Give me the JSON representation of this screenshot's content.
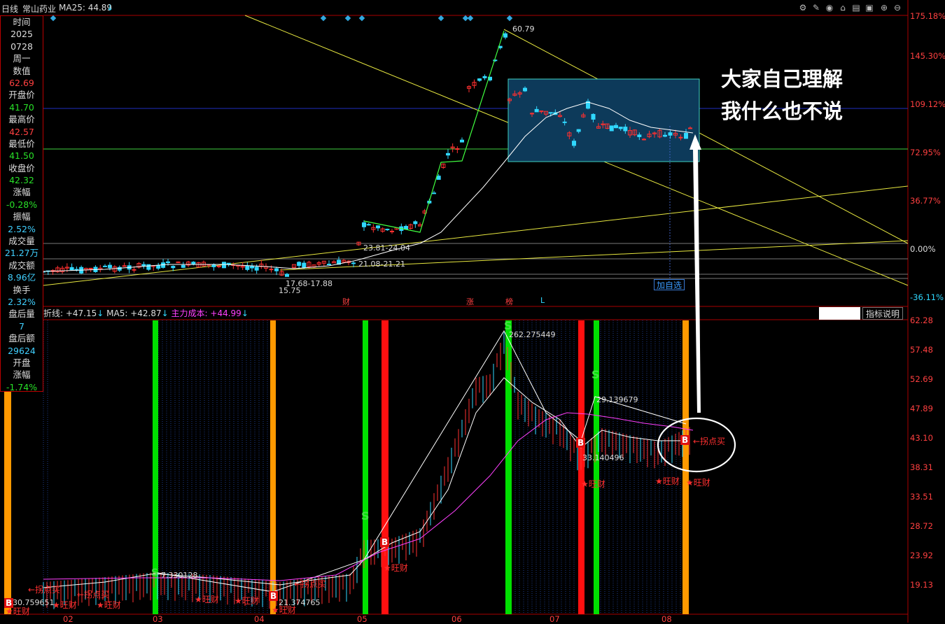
{
  "header": {
    "period": "日线",
    "stock_name": "常山药业",
    "ma_label": "MA25: 44.89",
    "ma_arrow": "↓"
  },
  "info_panel": {
    "items": [
      {
        "label": "时间",
        "value": ""
      },
      {
        "label": "2025",
        "value": ""
      },
      {
        "label": "0728",
        "value": ""
      },
      {
        "label": "周一",
        "value": ""
      },
      {
        "label": "数值",
        "value": "62.69",
        "color": "red"
      },
      {
        "label": "开盘价",
        "value": "41.70",
        "color": "green"
      },
      {
        "label": "最高价",
        "value": "42.57",
        "color": "red"
      },
      {
        "label": "最低价",
        "value": "41.50",
        "color": "green"
      },
      {
        "label": "收盘价",
        "value": "42.32",
        "color": "green"
      },
      {
        "label": "涨幅",
        "value": "-0.28%",
        "color": "green"
      },
      {
        "label": "振幅",
        "value": "2.52%",
        "color": "cyan"
      },
      {
        "label": "成交量",
        "value": "21.27万",
        "color": "cyan"
      },
      {
        "label": "成交额",
        "value": "8.96亿",
        "color": "cyan"
      },
      {
        "label": "换手",
        "value": "2.32%",
        "color": "cyan"
      },
      {
        "label": "盘后量",
        "value": "7",
        "color": "cyan"
      },
      {
        "label": "盘后额",
        "value": "29624",
        "color": "cyan"
      },
      {
        "label": "开盘",
        "value": ""
      },
      {
        "label": "涨幅",
        "value": "-1.74%",
        "color": "green"
      }
    ]
  },
  "main_axis": [
    "175.18%",
    "145.30%",
    "109.12%",
    "72.95%",
    "36.77%",
    "0.00%",
    "-36.11%"
  ],
  "indicator_axis": [
    "62.28",
    "57.48",
    "52.69",
    "47.89",
    "43.10",
    "38.31",
    "33.51",
    "28.72",
    "23.92",
    "19.13"
  ],
  "time_axis": [
    "02",
    "03",
    "04",
    "05",
    "06",
    "07",
    "08"
  ],
  "price_labels": {
    "high": "60.79",
    "range1": "23.81-24.04",
    "range2": "21.08-21.21",
    "range3": "17.68-17.88",
    "low": "15.75"
  },
  "event_marks": [
    "财",
    "涨",
    "榜",
    "L"
  ],
  "add_favorite": "加自选",
  "annotation": {
    "line1": "大家自己理解",
    "line2": "我什么也不说"
  },
  "indicator_header": {
    "a": "折线: +47.15",
    "a_arrow": "↓",
    "b": "MA5: +42.87",
    "b_arrow": "↓",
    "c": "主力成本: +44.99",
    "c_arrow": "↓"
  },
  "indicator_labels": {
    "v1": "262.275449",
    "v2": "29.139679",
    "v3": "33.140496",
    "v4": "21.374765",
    "v5": "30.759651",
    "v6": "7.330128",
    "buy": "←拐点买",
    "rich": "★旺财",
    "s": "S",
    "b": "B"
  },
  "indicator_explain": "指标说明",
  "colors": {
    "up": "#ff3030",
    "down": "#30d8ff",
    "yellow_line": "#e8e840",
    "green_band": "#00e000",
    "red_band": "#ff1010",
    "orange_band": "#ff9900",
    "magenta": "#ff40ff",
    "box_fill": "#0d3a5a"
  },
  "chart_data": {
    "type": "candlestick",
    "x": [
      "02",
      "03",
      "04",
      "05",
      "06",
      "07",
      "08"
    ],
    "series": [
      {
        "values": [
          15.75,
          17.88,
          21.21,
          24.04,
          45.0,
          60.79,
          42.32
        ]
      }
    ],
    "ylim_pct": [
      -36.11,
      175.18
    ]
  }
}
